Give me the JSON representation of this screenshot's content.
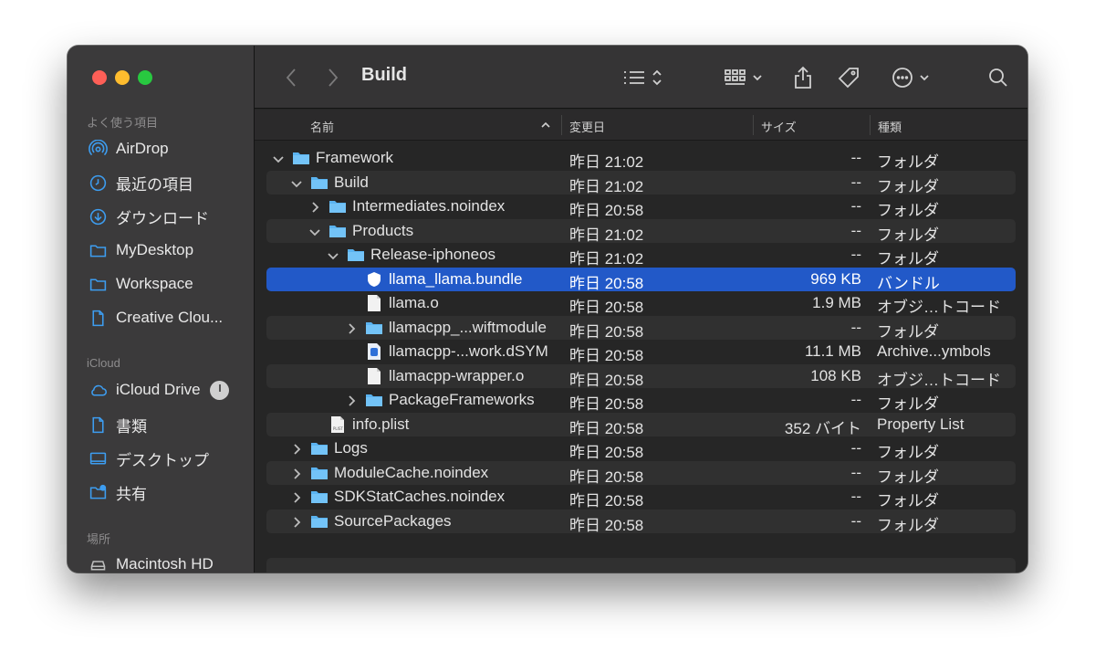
{
  "window": {
    "title": "Build"
  },
  "sidebar": {
    "favorites_label": "よく使う項目",
    "favorites": [
      {
        "label": "AirDrop",
        "icon": "airdrop-icon"
      },
      {
        "label": "最近の項目",
        "icon": "clock-icon"
      },
      {
        "label": "ダウンロード",
        "icon": "download-icon"
      },
      {
        "label": "MyDesktop",
        "icon": "folder-icon"
      },
      {
        "label": "Workspace",
        "icon": "folder-icon"
      },
      {
        "label": "Creative Clou...",
        "icon": "document-icon"
      }
    ],
    "icloud_label": "iCloud",
    "icloud": [
      {
        "label": "iCloud Drive",
        "icon": "cloud-icon"
      },
      {
        "label": "書類",
        "icon": "document-icon"
      },
      {
        "label": "デスクトップ",
        "icon": "desktop-icon"
      },
      {
        "label": "共有",
        "icon": "shared-folder-icon"
      }
    ],
    "locations_label": "場所",
    "locations": [
      {
        "label": "Macintosh HD",
        "icon": "disk-icon"
      }
    ]
  },
  "columns": {
    "name": "名前",
    "date": "変更日",
    "size": "サイズ",
    "kind": "種類"
  },
  "files": [
    {
      "name": "Framework",
      "date": "昨日 21:02",
      "size": "--",
      "kind": "フォルダ",
      "type": "folder",
      "expanded": true,
      "depth": 0
    },
    {
      "name": "Build",
      "date": "昨日 21:02",
      "size": "--",
      "kind": "フォルダ",
      "type": "folder",
      "expanded": true,
      "depth": 1
    },
    {
      "name": "Intermediates.noindex",
      "date": "昨日 20:58",
      "size": "--",
      "kind": "フォルダ",
      "type": "folder",
      "expanded": false,
      "depth": 2
    },
    {
      "name": "Products",
      "date": "昨日 21:02",
      "size": "--",
      "kind": "フォルダ",
      "type": "folder",
      "expanded": true,
      "depth": 2
    },
    {
      "name": "Release-iphoneos",
      "date": "昨日 21:02",
      "size": "--",
      "kind": "フォルダ",
      "type": "folder",
      "expanded": true,
      "depth": 3
    },
    {
      "name": "llama_llama.bundle",
      "date": "昨日 20:58",
      "size": "969 KB",
      "kind": "バンドル",
      "type": "bundle",
      "depth": 4,
      "selected": true
    },
    {
      "name": "llama.o",
      "date": "昨日 20:58",
      "size": "1.9 MB",
      "kind": "オブジ…トコード",
      "type": "file",
      "depth": 4
    },
    {
      "name": "llamacpp_...wiftmodule",
      "date": "昨日 20:58",
      "size": "--",
      "kind": "フォルダ",
      "type": "folder",
      "expanded": false,
      "depth": 4
    },
    {
      "name": "llamacpp-...work.dSYM",
      "date": "昨日 20:58",
      "size": "11.1 MB",
      "kind": "Archive...ymbols",
      "type": "dsym",
      "depth": 4
    },
    {
      "name": "llamacpp-wrapper.o",
      "date": "昨日 20:58",
      "size": "108 KB",
      "kind": "オブジ…トコード",
      "type": "file",
      "depth": 4
    },
    {
      "name": "PackageFrameworks",
      "date": "昨日 20:58",
      "size": "--",
      "kind": "フォルダ",
      "type": "folder",
      "expanded": false,
      "depth": 4
    },
    {
      "name": "info.plist",
      "date": "昨日 20:58",
      "size": "352 バイト",
      "kind": "Property List",
      "type": "plist",
      "depth": 2
    },
    {
      "name": "Logs",
      "date": "昨日 20:58",
      "size": "--",
      "kind": "フォルダ",
      "type": "folder",
      "expanded": false,
      "depth": 1
    },
    {
      "name": "ModuleCache.noindex",
      "date": "昨日 20:58",
      "size": "--",
      "kind": "フォルダ",
      "type": "folder",
      "expanded": false,
      "depth": 1
    },
    {
      "name": "SDKStatCaches.noindex",
      "date": "昨日 20:58",
      "size": "--",
      "kind": "フォルダ",
      "type": "folder",
      "expanded": false,
      "depth": 1
    },
    {
      "name": "SourcePackages",
      "date": "昨日 20:58",
      "size": "--",
      "kind": "フォルダ",
      "type": "folder",
      "expanded": false,
      "depth": 1
    }
  ],
  "colors": {
    "accent": "#2259c8",
    "folder": "#5ab3f0",
    "close": "#fe5f57",
    "minimize": "#febc2e",
    "zoom": "#28c840"
  }
}
